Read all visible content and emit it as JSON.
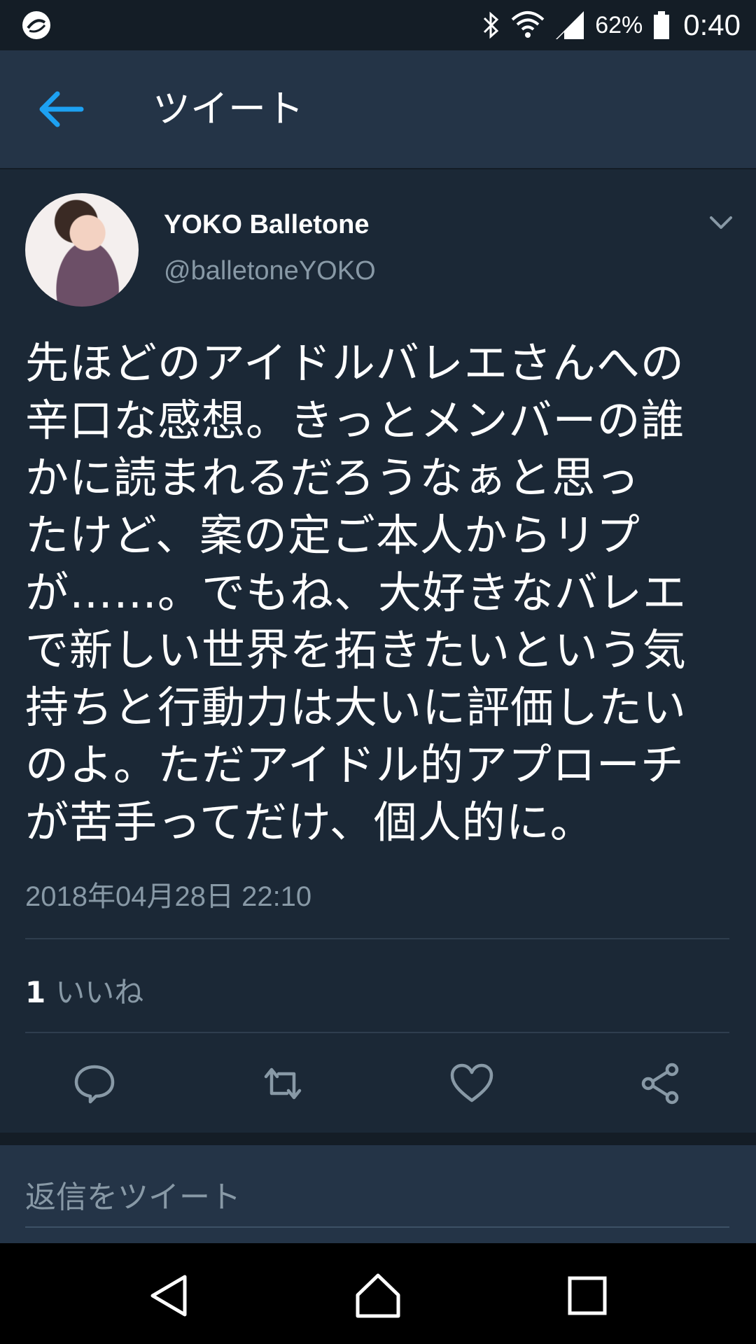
{
  "status_bar": {
    "battery_percent": "62%",
    "time": "0:40",
    "icons": [
      "app-logo-icon",
      "bluetooth-icon",
      "wifi-icon",
      "signal-icon",
      "battery-icon"
    ]
  },
  "toolbar": {
    "title": "ツイート",
    "back_icon": "arrow-left-icon"
  },
  "tweet": {
    "author_name": "YOKO Balletone",
    "author_handle": "@balletoneYOKO",
    "text": "先ほどのアイドルバレエさんへの\n辛口な感想。きっとメンバーの誰\nかに読まれるだろうなぁと思っ\nたけど、案の定ご本人からリプ\nが……。でもね、大好きなバレエ\nで新しい世界を拓きたいという気\n持ちと行動力は大いに評価したい\nのよ。ただアイドル的アプローチ\nが苦手ってだけ、個人的に。",
    "timestamp": "2018年04月28日 22:10",
    "like_count": "1",
    "like_label": "いいね"
  },
  "actions": [
    "reply-icon",
    "retweet-icon",
    "like-icon",
    "share-icon"
  ],
  "reply": {
    "placeholder": "返信をツイート"
  },
  "colors": {
    "background": "#1b2836",
    "toolbar": "#243447",
    "accent": "#1da1f2",
    "secondary_text": "#8899a6"
  }
}
